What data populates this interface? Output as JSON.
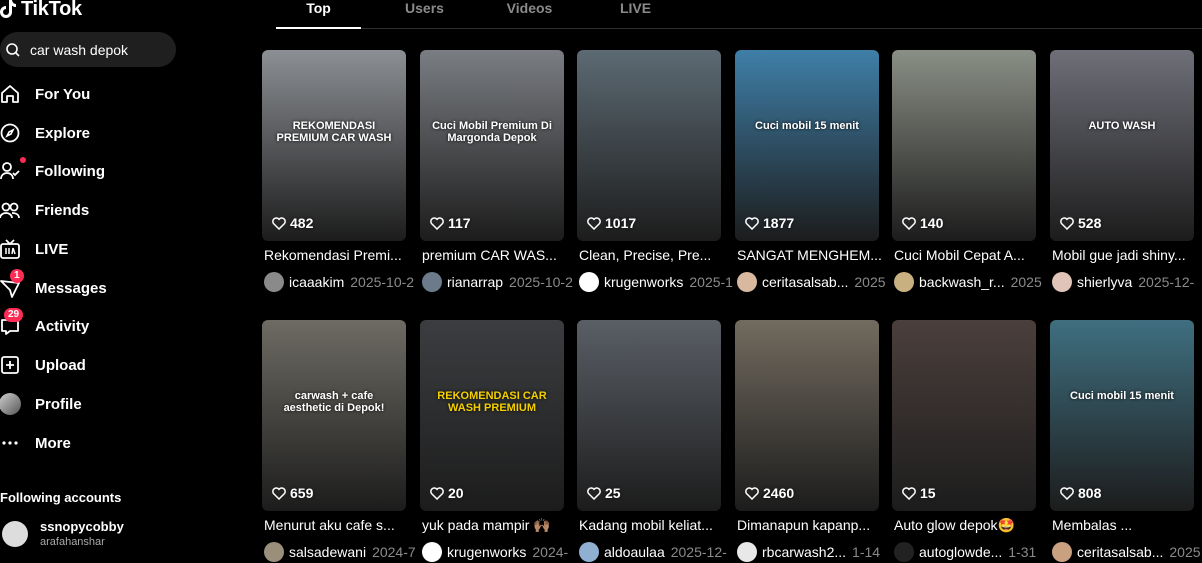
{
  "app": {
    "logo_text": "TikTok"
  },
  "search": {
    "value": "car wash depok"
  },
  "nav": [
    {
      "label": "For You",
      "icon": "home-icon"
    },
    {
      "label": "Explore",
      "icon": "compass-icon"
    },
    {
      "label": "Following",
      "icon": "following-icon"
    },
    {
      "label": "Friends",
      "icon": "friends-icon"
    },
    {
      "label": "LIVE",
      "icon": "live-icon"
    },
    {
      "label": "Messages",
      "icon": "messages-icon",
      "badge": "1"
    },
    {
      "label": "Activity",
      "icon": "activity-icon",
      "badge": "29"
    },
    {
      "label": "Upload",
      "icon": "upload-icon"
    },
    {
      "label": "Profile",
      "icon": "profile-avatar"
    },
    {
      "label": "More",
      "icon": "more-icon"
    }
  ],
  "following_accounts": {
    "title": "Following accounts",
    "items": [
      {
        "name": "ssnopycobby",
        "handle": "arafahanshar"
      }
    ]
  },
  "tabs": [
    "Top",
    "Users",
    "Videos",
    "LIVE"
  ],
  "active_tab": "Top",
  "videos": [
    {
      "likes": "482",
      "caption": "Rekomendasi Premi...",
      "user": "icaaakim",
      "date": "2025-10-2",
      "thumb_bg": "#8c8f94",
      "overlay": "REKOMENDASI PREMIUM CAR WASH"
    },
    {
      "likes": "117",
      "caption": "premium CAR WAS...",
      "user": "rianarrap",
      "date": "2025-10-2",
      "thumb_bg": "#7a7d82",
      "overlay": "Cuci Mobil Premium Di Margonda Depok"
    },
    {
      "likes": "1017",
      "caption": "Clean, Precise, Pre...",
      "user": "krugenworks",
      "date": "2025-1",
      "thumb_bg": "#5c6a73",
      "overlay": ""
    },
    {
      "likes": "1877",
      "caption": "SANGAT MENGHEM...",
      "user": "ceritasalsab...",
      "date": "2025",
      "thumb_bg": "#3f7fa8",
      "overlay": "Cuci mobil 15 menit"
    },
    {
      "likes": "140",
      "caption": "Cuci Mobil Cepat A...",
      "user": "backwash_r...",
      "date": "2025",
      "thumb_bg": "#8a8f85",
      "overlay": ""
    },
    {
      "likes": "528",
      "caption": "Mobil gue jadi shiny...",
      "user": "shierlyva",
      "date": "2025-12-",
      "thumb_bg": "#6e6f78",
      "overlay": "AUTO WASH"
    },
    {
      "likes": "659",
      "caption": "Menurut aku cafe s...",
      "user": "salsadewani",
      "date": "2024-7",
      "thumb_bg": "#6d6b63",
      "overlay": "carwash + cafe aesthetic di Depok!"
    },
    {
      "likes": "20",
      "caption": "yuk pada mampir 🙌🏽",
      "user": "krugenworks",
      "date": "2024-",
      "thumb_bg": "#3b3d40",
      "overlay": "REKOMENDASI CAR WASH PREMIUM"
    },
    {
      "likes": "25",
      "caption": "Kadang mobil keliat...",
      "user": "aldoaulaa",
      "date": "2025-12-",
      "thumb_bg": "#5a5f66",
      "overlay": ""
    },
    {
      "likes": "2460",
      "caption": "Dimanapun kapanp...",
      "user": "rbcarwash2...",
      "date": "1-14",
      "thumb_bg": "#726b5f",
      "overlay": ""
    },
    {
      "likes": "15",
      "caption": "Auto glow depok🤩",
      "user": "autoglowde...",
      "date": "1-31",
      "thumb_bg": "#4b3f3c",
      "overlay": ""
    },
    {
      "likes": "808",
      "caption": "Membalas ...",
      "user": "ceritasalsab...",
      "date": "2025",
      "thumb_bg": "#3f6f80",
      "overlay": "Cuci mobil 15 menit"
    }
  ],
  "colors": {
    "accent": "#fe2c55",
    "background": "#000000",
    "muted": "#8a8a8a"
  }
}
